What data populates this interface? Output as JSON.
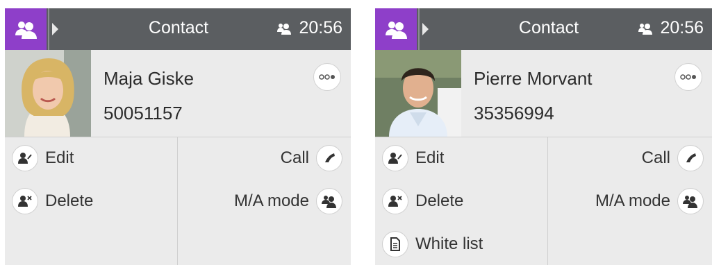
{
  "colors": {
    "accent": "#8e3fc9",
    "topbar": "#5b5e61",
    "panel": "#ebebeb"
  },
  "screens": [
    {
      "topbar": {
        "title": "Contact",
        "time": "20:56",
        "status_icon": "group-icon"
      },
      "contact": {
        "name": "Maja Giske",
        "number": "50051157"
      },
      "actions_left": [
        "Edit",
        "Delete"
      ],
      "actions_right": [
        "Call",
        "M/A mode"
      ]
    },
    {
      "topbar": {
        "title": "Contact",
        "time": "20:56",
        "status_icon": "group-icon"
      },
      "contact": {
        "name": "Pierre Morvant",
        "number": "35356994"
      },
      "actions_left": [
        "Edit",
        "Delete",
        "White list"
      ],
      "actions_right": [
        "Call",
        "M/A mode"
      ]
    }
  ]
}
